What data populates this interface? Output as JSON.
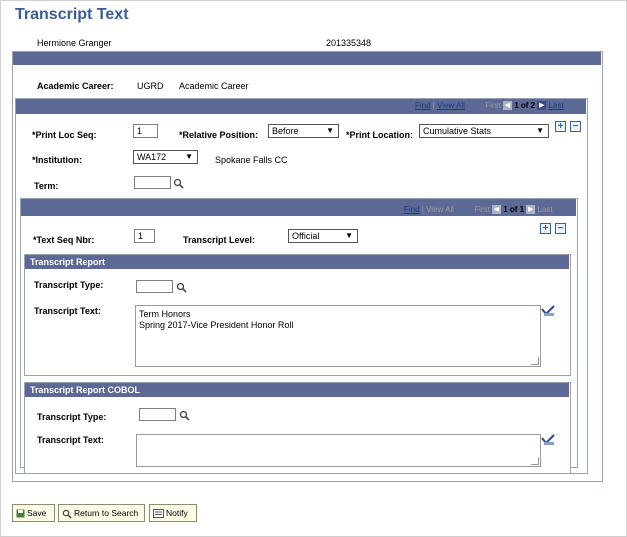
{
  "page": {
    "title": "Transcript Text"
  },
  "student": {
    "name": "Hermione Granger",
    "id": "201335348"
  },
  "career": {
    "label": "Academic Career:",
    "code": "UGRD",
    "description": "Academic Career"
  },
  "outer_nav": {
    "find": "Find",
    "view_all": "View All",
    "first": "First",
    "page_info": "1 of 2",
    "last": "Last"
  },
  "print_loc": {
    "seq_label": "*Print Loc Seq:",
    "seq_value": "1",
    "rel_pos_label": "*Relative Position:",
    "rel_pos_value": "Before",
    "location_label": "*Print Location:",
    "location_value": "Cumulative Stats",
    "institution_label": "*Institution:",
    "institution_value": "WA172",
    "institution_desc": "Spokane Falls CC",
    "term_label": "Term:",
    "term_value": ""
  },
  "inner_nav": {
    "find": "Find",
    "view_all": "View All",
    "first": "First",
    "page_info": "1 of 1",
    "last": "Last"
  },
  "text_seq": {
    "label": "*Text Seq Nbr:",
    "value": "1",
    "level_label": "Transcript Level:",
    "level_value": "Official"
  },
  "report": {
    "header": "Transcript Report",
    "type_label": "Transcript Type:",
    "type_value": "",
    "text_label": "Transcript Text:",
    "text_line1": "Term Honors",
    "text_line2": "Spring 2017-Vice President Honor Roll"
  },
  "cobol": {
    "header": "Transcript Report COBOL",
    "type_label": "Transcript Type:",
    "type_value": "",
    "text_label": "Transcript Text:",
    "text_value": ""
  },
  "toolbar": {
    "save": "Save",
    "return": "Return to Search",
    "notify": "Notify"
  },
  "colors": {
    "title": "#3b5b9a",
    "bar": "#5c6995",
    "link": "#1c3a8c",
    "button_bg": "#fbfbe6"
  },
  "icons": {
    "add": "+",
    "remove": "−",
    "lookup": "magnifier-icon",
    "spell": "spell-check-icon"
  }
}
